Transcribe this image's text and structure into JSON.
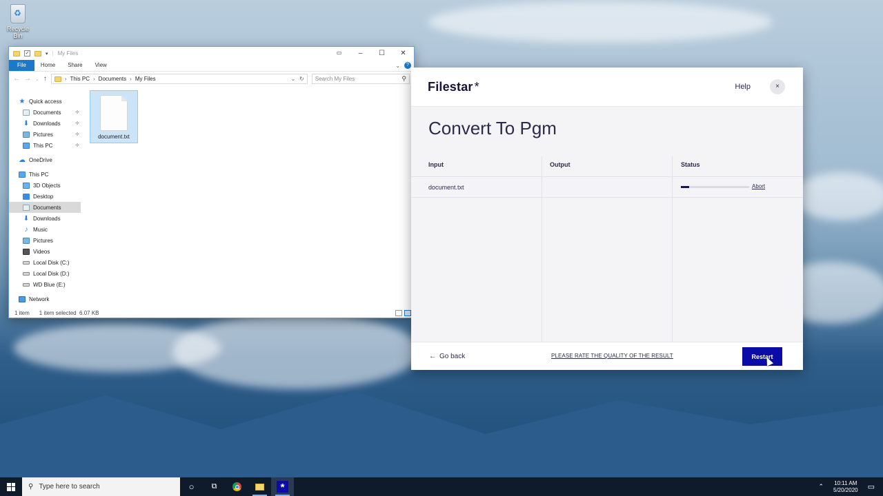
{
  "desktop": {
    "recycle_bin_label": "Recycle Bin"
  },
  "explorer": {
    "title": "My Files",
    "ribbon_tabs": [
      "File",
      "Home",
      "Share",
      "View"
    ],
    "breadcrumb": [
      "This PC",
      "Documents",
      "My Files"
    ],
    "search_placeholder": "Search My Files",
    "nav": {
      "quick_access": "Quick access",
      "quick_items": [
        "Documents",
        "Downloads",
        "Pictures",
        "This PC"
      ],
      "onedrive": "OneDrive",
      "this_pc": "This PC",
      "pc_items": [
        "3D Objects",
        "Desktop",
        "Documents",
        "Downloads",
        "Music",
        "Pictures",
        "Videos",
        "Local Disk (C:)",
        "Local Disk (D:)",
        "WD Blue (E:)"
      ],
      "network": "Network"
    },
    "files": [
      {
        "name": "document.txt"
      }
    ],
    "status": {
      "count": "1 item",
      "selected": "1 item selected  6.07 KB"
    }
  },
  "filestar": {
    "logo": "Filestar",
    "logo_mark": "*",
    "help": "Help",
    "close": "×",
    "title": "Convert To Pgm",
    "columns": {
      "input": "Input",
      "output": "Output",
      "status": "Status"
    },
    "rows": [
      {
        "input": "document.txt",
        "output": "",
        "progress_pct": 12,
        "action": "Abort"
      }
    ],
    "footer": {
      "go_back": "Go back",
      "rate": "PLEASE RATE THE QUALITY OF THE RESULT",
      "restart": "Restart"
    }
  },
  "taskbar": {
    "search_placeholder": "Type here to search",
    "time": "10:11 AM",
    "date": "5/20/2020"
  }
}
